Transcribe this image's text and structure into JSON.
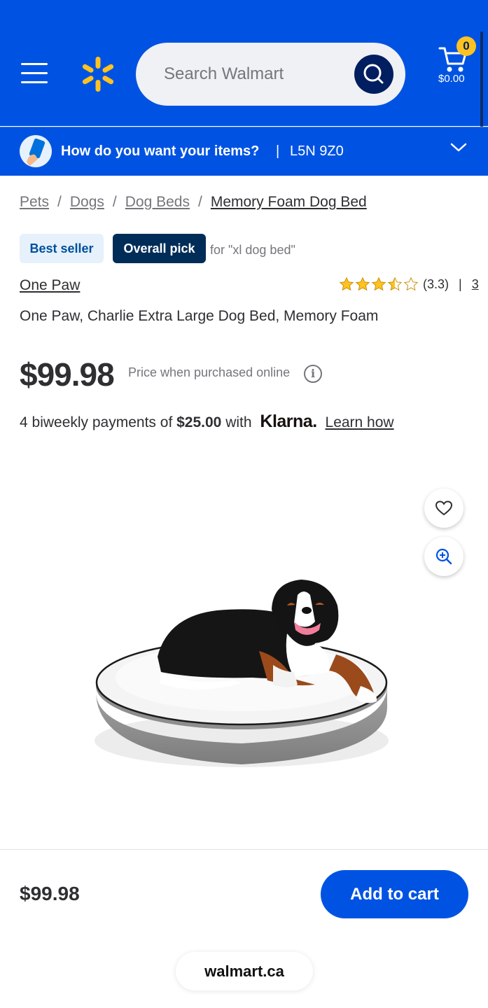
{
  "header": {
    "search_placeholder": "Search Walmart",
    "cart_count": "0",
    "cart_total": "$0.00",
    "brand_color": "#0053e2",
    "spark_color": "#ffc220"
  },
  "delivery": {
    "question": "How do you want your items?",
    "separator": "|",
    "postal_code": "L5N 9Z0"
  },
  "breadcrumb": [
    "Pets",
    "Dogs",
    "Dog Beds",
    "Memory Foam Dog Bed"
  ],
  "badges": {
    "best_seller": "Best seller",
    "overall_pick": "Overall pick",
    "pick_for": "for \"xl dog bed\""
  },
  "product": {
    "brand": "One Paw",
    "rating_value": 3.3,
    "rating_text": "(3.3)",
    "review_count": "3",
    "title": "One Paw, Charlie Extra Large Dog Bed, Memory Foam",
    "price": "$99.98",
    "price_note": "Price when purchased online",
    "info_glyph": "i"
  },
  "klarna": {
    "prefix": "4 biweekly payments of",
    "amount": "$25.00",
    "with": "with",
    "logo": "Klarna.",
    "link": "Learn how"
  },
  "icons": {
    "favorite": "heart-icon",
    "zoom": "zoom-in-icon"
  },
  "sticky": {
    "price": "$99.98",
    "add_to_cart": "Add to cart"
  },
  "domain": "walmart.ca"
}
